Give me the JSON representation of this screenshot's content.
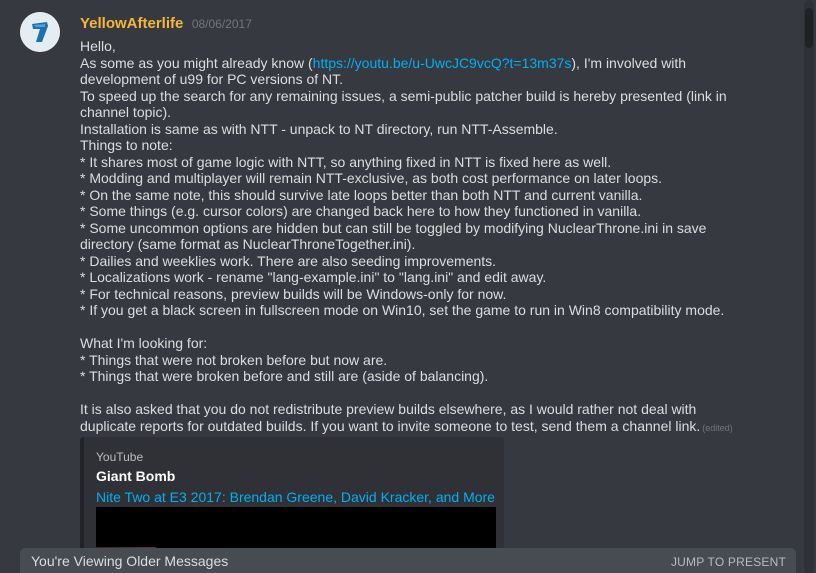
{
  "message": {
    "avatar_icon": "discord-logo-icon",
    "username": "YellowAfterlife",
    "timestamp": "08/06/2017",
    "lines": [
      {
        "before": "Hello,"
      },
      {
        "before": "As some as you might already know (",
        "link": "https://youtu.be/u-UwcJC9vcQ?t=13m37s",
        "after": "), I'm involved with"
      },
      {
        "before": "development of u99 for PC versions of NT."
      },
      {
        "before": "To speed up the search for any remaining issues, a semi-public patcher build is hereby presented (link in"
      },
      {
        "before": "channel topic)."
      },
      {
        "before": "Installation is same as with NTT - unpack to NT directory, run NTT-Assemble."
      },
      {
        "before": "Things to note:"
      },
      {
        "before": "* It shares most of game logic with NTT, so anything fixed in NTT is fixed here as well."
      },
      {
        "before": "* Modding and multiplayer will remain NTT-exclusive, as both cost performance on later loops."
      },
      {
        "before": "* On the same note, this should survive late loops better than both NTT and current vanilla."
      },
      {
        "before": "* Some things (e.g. cursor colors) are changed back here to how they functioned in vanilla."
      },
      {
        "before": "* Some uncommon options are hidden but can still be toggled by modifying NuclearThrone.ini in save"
      },
      {
        "before": "directory (same format as NuclearThroneTogether.ini)."
      },
      {
        "before": "* Dailies and weeklies work. There are also seeding improvements."
      },
      {
        "before": "* Localizations work - rename \"lang-example.ini\" to \"lang.ini\" and edit away."
      },
      {
        "before": "* For technical reasons, preview builds will be Windows-only for now."
      },
      {
        "before": "* If you get a black screen in fullscreen mode on Win10, set the game to run in Win8 compatibility mode."
      },
      {
        "before": ""
      },
      {
        "before": "What I'm looking for:"
      },
      {
        "before": "* Things that were not broken before but now are."
      },
      {
        "before": "* Things that were broken before and still are (aside of balancing)."
      },
      {
        "before": ""
      },
      {
        "before": "It is also asked that you do not redistribute preview builds elsewhere, as I would rather not deal with"
      },
      {
        "before": "duplicate reports for outdated builds. If you want to invite someone to test, send them a channel link.",
        "edited": "(edited)"
      }
    ]
  },
  "embed": {
    "provider": "YouTube",
    "author": "Giant Bomb",
    "title": "Nite Two at E3 2017: Brendan Greene, David Kracker, and More"
  },
  "older_bar": {
    "text": "You're Viewing Older Messages",
    "jump_label": "JUMP TO PRESENT"
  }
}
